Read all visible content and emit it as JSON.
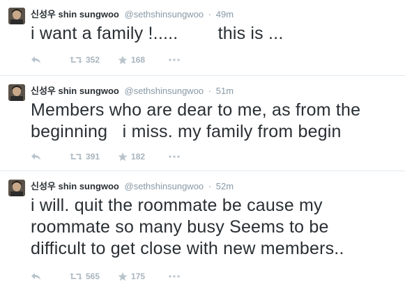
{
  "tweets": [
    {
      "name": "신성우 shin sungwoo",
      "handle": "@sethshinsungwoo",
      "separator": "·",
      "time": "49m",
      "text": "i want a family !.....        this is ...",
      "retweets": "352",
      "favorites": "168"
    },
    {
      "name": "신성우 shin sungwoo",
      "handle": "@sethshinsungwoo",
      "separator": "·",
      "time": "51m",
      "text": "Members who are dear to me, as from the\nbeginning   i miss. my family from begin",
      "retweets": "391",
      "favorites": "182"
    },
    {
      "name": "신성우 shin sungwoo",
      "handle": "@sethshinsungwoo",
      "separator": "·",
      "time": "52m",
      "text": "i will. quit the roommate be cause my\nroommate so many busy Seems to be\ndifficult to get close with new members..",
      "retweets": "565",
      "favorites": "175"
    }
  ],
  "colors": {
    "text": "#292f33",
    "meta": "#8899a6",
    "action": "#a8b4bd",
    "divider": "#e1e8ed"
  },
  "icons": {
    "reply": "reply-icon",
    "retweet": "retweet-icon",
    "favorite": "star-icon",
    "more": "more-dots-icon"
  }
}
